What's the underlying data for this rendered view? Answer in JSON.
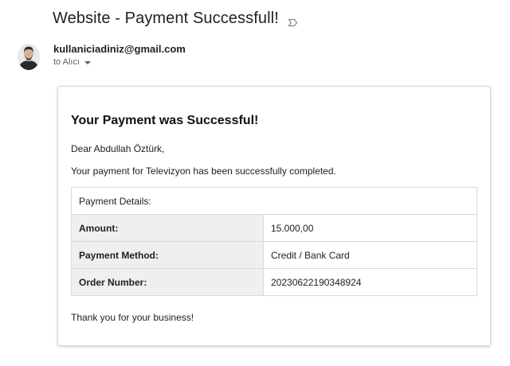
{
  "email": {
    "subject": "Website - Payment Successfull!",
    "sender": "kullaniciadiniz@gmail.com",
    "recipient": "to Alıcı"
  },
  "body": {
    "title": "Your Payment was Successful!",
    "greeting": "Dear Abdullah Öztürk,",
    "message": "Your payment for Televizyon has been successfully completed.",
    "details_header": "Payment Details:",
    "rows": [
      {
        "label": "Amount:",
        "value": "15.000,00"
      },
      {
        "label": "Payment Method:",
        "value": "Credit / Bank Card"
      },
      {
        "label": "Order Number:",
        "value": "20230622190348924"
      }
    ],
    "closing": "Thank you for your business!"
  },
  "icons": {
    "label": "label-outline-icon",
    "avatar": "avatar-photo",
    "dropdown": "chevron-down-icon"
  },
  "colors": {
    "text": "#202124",
    "muted": "#5f6368",
    "row_label_bg": "#efefef",
    "border": "#d9d9d9"
  }
}
